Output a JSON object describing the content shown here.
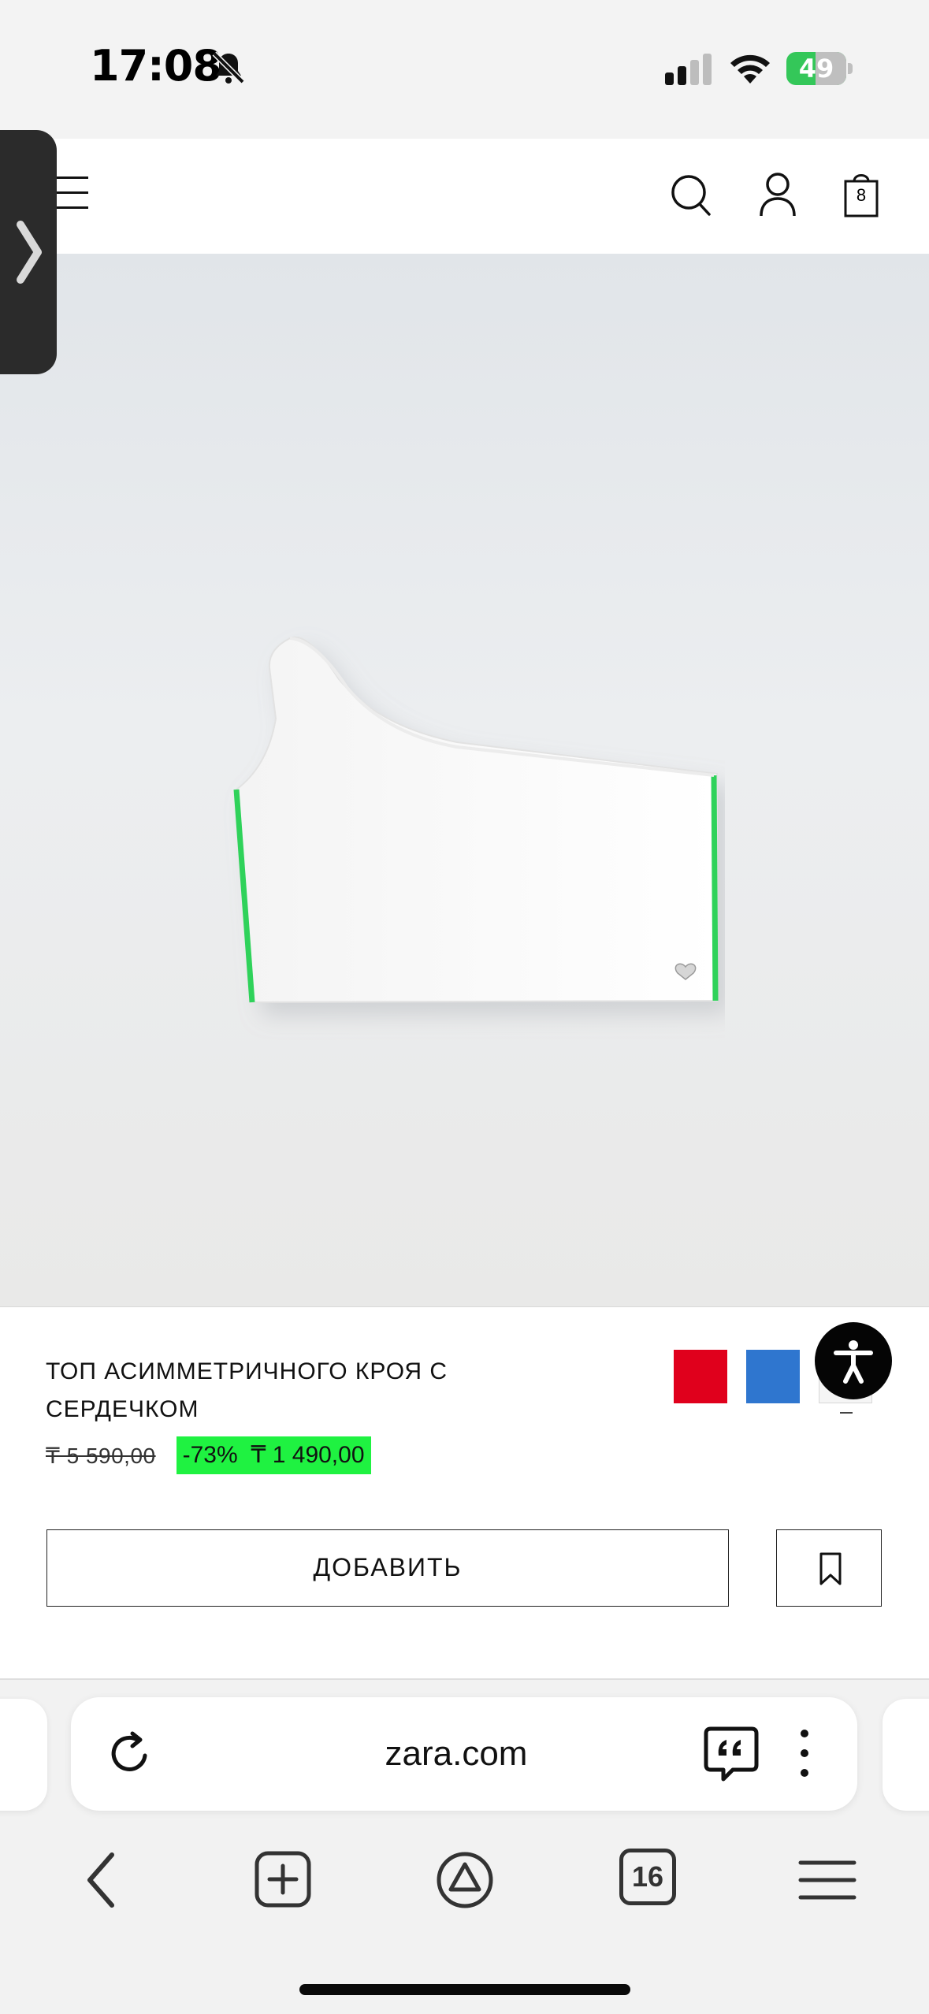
{
  "status_bar": {
    "time": "17:08",
    "battery": "49",
    "battery_level": 0.49,
    "icons": [
      "bell-slash-icon",
      "cellular-signal-icon",
      "wifi-icon",
      "battery-charging-icon"
    ]
  },
  "header": {
    "menu_icon": "hamburger-menu-icon",
    "search_icon": "search-icon",
    "account_icon": "user-icon",
    "cart_icon": "shopping-bag-icon",
    "cart_count": "8"
  },
  "side_panel": {
    "icon": "chevron-right-icon"
  },
  "product": {
    "title": "ТОП АСИММЕТРИЧНОГО КРОЯ С СЕРДЕЧКОМ",
    "old_price": "₸ 5 590,00",
    "discount": "-73%",
    "price": "₸ 1 490,00",
    "sale_tag_color": "#1ff241",
    "colors": [
      {
        "name": "red",
        "hex": "#e0001c",
        "selected": false
      },
      {
        "name": "blue",
        "hex": "#2f76cf",
        "selected": false
      },
      {
        "name": "white",
        "hex": "#f5f5f5",
        "selected": true
      }
    ],
    "add_button": "ДОБАВИТЬ",
    "bookmark_icon": "bookmark-icon",
    "accessibility_icon": "accessibility-icon"
  },
  "browser": {
    "url": "zara.com",
    "reload_icon": "reload-icon",
    "quote_icon": "quote-bubble-icon",
    "more_icon": "more-vertical-icon",
    "nav": {
      "back_icon": "back-chevron-icon",
      "new_tab_icon": "plus-square-icon",
      "alice_icon": "assistant-icon",
      "tab_count": "16",
      "menu_icon": "menu-icon"
    }
  }
}
